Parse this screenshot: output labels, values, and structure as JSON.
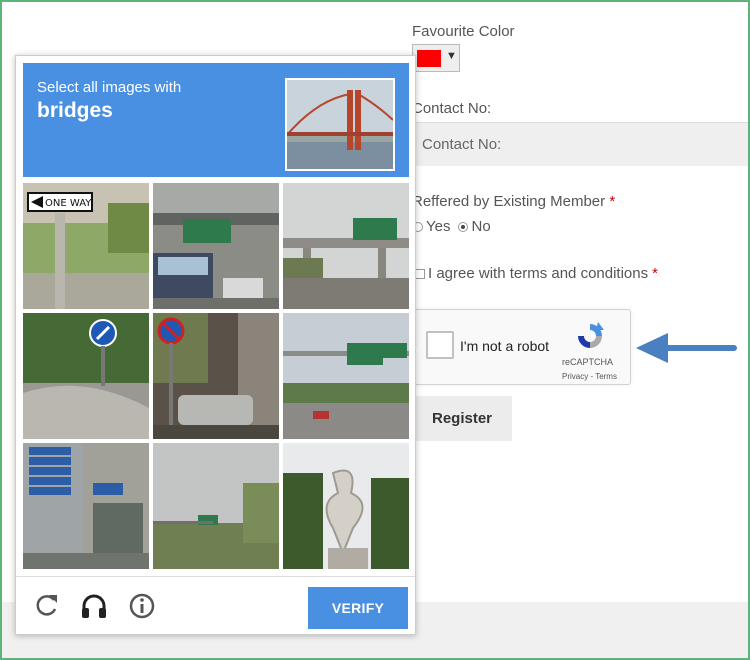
{
  "form": {
    "favourite_color_label": "Favourite Color",
    "selected_color": "#ff0000",
    "color_caret": "▼",
    "contact_label": "Contact No:",
    "contact_placeholder": "Contact No:",
    "referred_label": "Reffered by Existing Member",
    "required_mark": "*",
    "radio_yes": "Yes",
    "radio_no": "No",
    "radio_selected": "No",
    "terms_label": "I agree with terms and conditions",
    "register_label": "Register"
  },
  "recaptcha": {
    "checkbox_label": "I'm not a robot",
    "brand": "reCAPTCHA",
    "links": "Privacy - Terms"
  },
  "challenge": {
    "instruction": "Select all images with",
    "target": "bridges",
    "verify_label": "VERIFY",
    "header_color": "#4a90e2",
    "tiles": [
      {
        "scene": "one-way-sign-pole",
        "sign_text": "ONE WAY"
      },
      {
        "scene": "highway-overpass-bus",
        "sign_text": ""
      },
      {
        "scene": "overpass-green-sign",
        "sign_text": ""
      },
      {
        "scene": "blue-arrow-sign-greenery",
        "sign_text": ""
      },
      {
        "scene": "no-parking-sign-car",
        "sign_text": ""
      },
      {
        "scene": "overhead-highway-signs",
        "sign_text": ""
      },
      {
        "scene": "street-signs-building",
        "sign_text": ""
      },
      {
        "scene": "field-green-sign",
        "sign_text": ""
      },
      {
        "scene": "sculpture-trees",
        "sign_text": ""
      }
    ]
  }
}
